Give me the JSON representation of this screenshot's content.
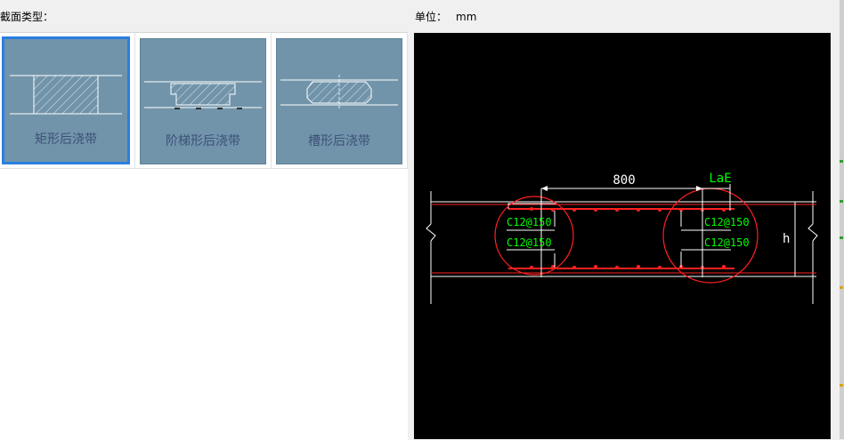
{
  "header": {
    "section_type_label": "截面类型：",
    "unit_label": "单位：",
    "unit_value": "mm"
  },
  "section_types": [
    {
      "label": "矩形后浇带",
      "selected": true
    },
    {
      "label": "阶梯形后浇带",
      "selected": false
    },
    {
      "label": "槽形后浇带",
      "selected": false
    }
  ],
  "preview": {
    "dimension_width": "800",
    "anchor_label": "LaE",
    "height_label": "h",
    "rebar_labels": {
      "left_top": "C12@150",
      "left_bottom": "C12@150",
      "right_top": "C12@150",
      "right_bottom": "C12@150"
    }
  },
  "colors": {
    "thumb_bg": "#7194aa",
    "selection": "#2b7fe0",
    "card_text": "#3d4f78",
    "rebar_red": "#ff2020",
    "cad_green": "#00ff00",
    "cad_white": "#ffffff"
  }
}
